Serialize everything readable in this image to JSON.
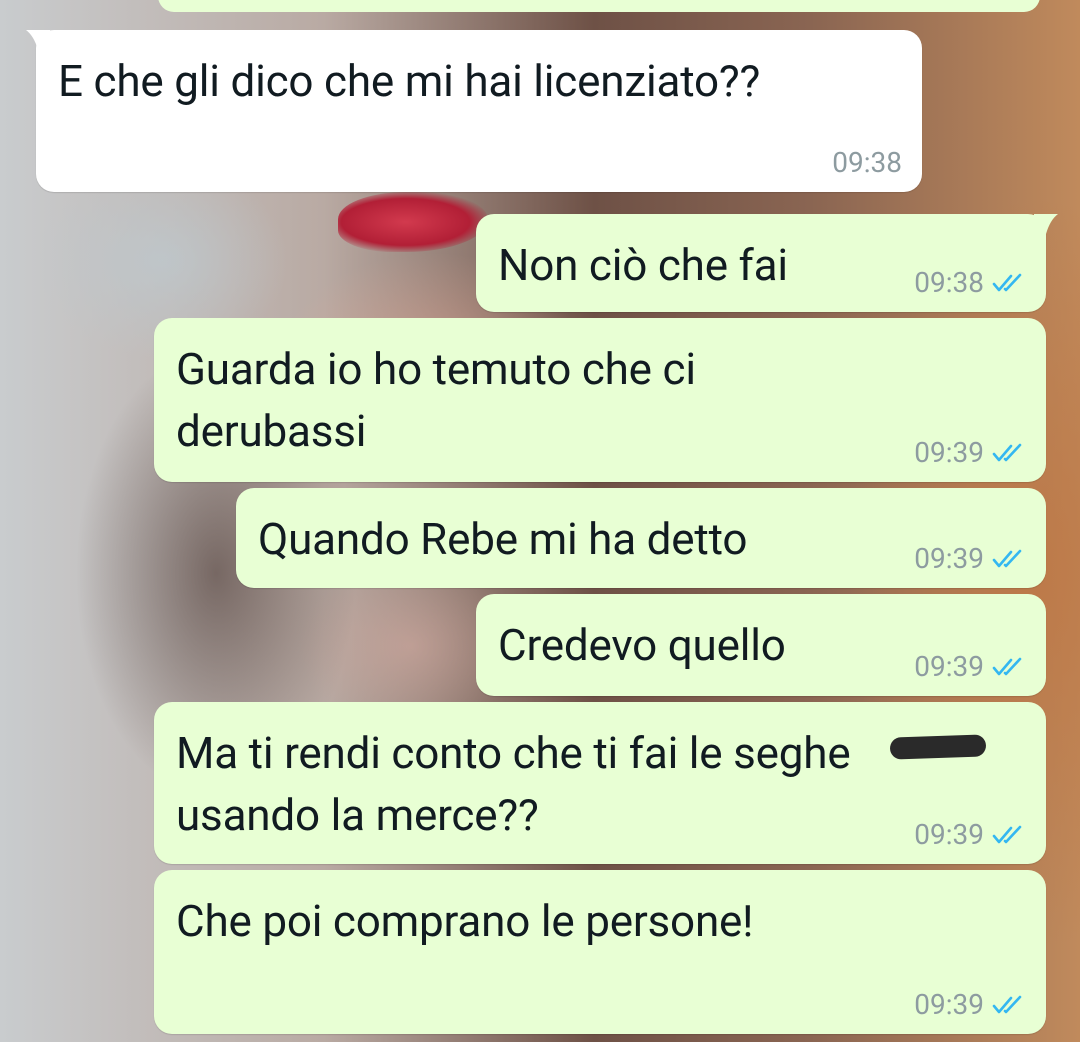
{
  "messages": [
    {
      "direction": "in",
      "text": "E che gli dico che mi hai licenziato??",
      "time": "09:38"
    },
    {
      "direction": "out",
      "text": "Non ciò che fai",
      "time": "09:38",
      "status": "read"
    },
    {
      "direction": "out",
      "text": "Guarda io ho temuto che ci\nderubassi",
      "time": "09:39",
      "status": "read"
    },
    {
      "direction": "out",
      "text": "Quando Rebe mi ha detto",
      "time": "09:39",
      "status": "read"
    },
    {
      "direction": "out",
      "text": "Credevo quello",
      "time": "09:39",
      "status": "read"
    },
    {
      "direction": "out",
      "text": "Ma ti rendi conto che ti fai le seghe\nusando la merce??",
      "time": "09:39",
      "status": "read"
    },
    {
      "direction": "out",
      "text": "Che poi comprano le persone!",
      "time": "09:39",
      "status": "read"
    }
  ],
  "icons": {
    "read_receipt": "double-check-icon"
  },
  "colors": {
    "incoming_bubble": "#ffffff",
    "outgoing_bubble": "#e8ffd4",
    "timestamp": "#8d9ba0",
    "read_tick": "#34b7f1"
  }
}
